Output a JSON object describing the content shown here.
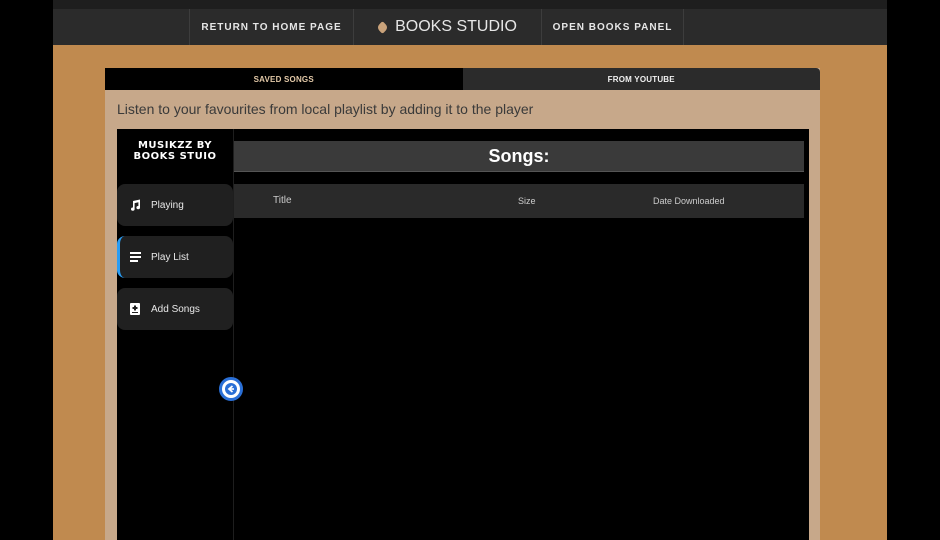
{
  "nav": {
    "home": "RETURN TO HOME PAGE",
    "brand": "BOOKS STUDIO",
    "panel": "OPEN BOOKS PANEL"
  },
  "tabs": [
    {
      "label": "SAVED SONGS",
      "active": true
    },
    {
      "label": "FROM YOUTUBE",
      "active": false
    }
  ],
  "intro": "Listen to your favourites from local playlist by adding it to the player",
  "player": {
    "logo_line1": "MUSIKZZ BY",
    "logo_line2": "BOOKS STUIO",
    "menu": [
      {
        "label": "Playing",
        "icon": "music-note-icon"
      },
      {
        "label": "Play List",
        "icon": "list-icon",
        "active": true
      },
      {
        "label": "Add Songs",
        "icon": "add-song-icon"
      }
    ],
    "songs_title": "Songs:",
    "columns": {
      "title": "Title",
      "size": "Size",
      "date": "Date Downloaded"
    },
    "rows": []
  },
  "colors": {
    "accent": "#2a9df4",
    "page_bg": "#c08a4f",
    "panel_bg": "#c7a88a"
  }
}
